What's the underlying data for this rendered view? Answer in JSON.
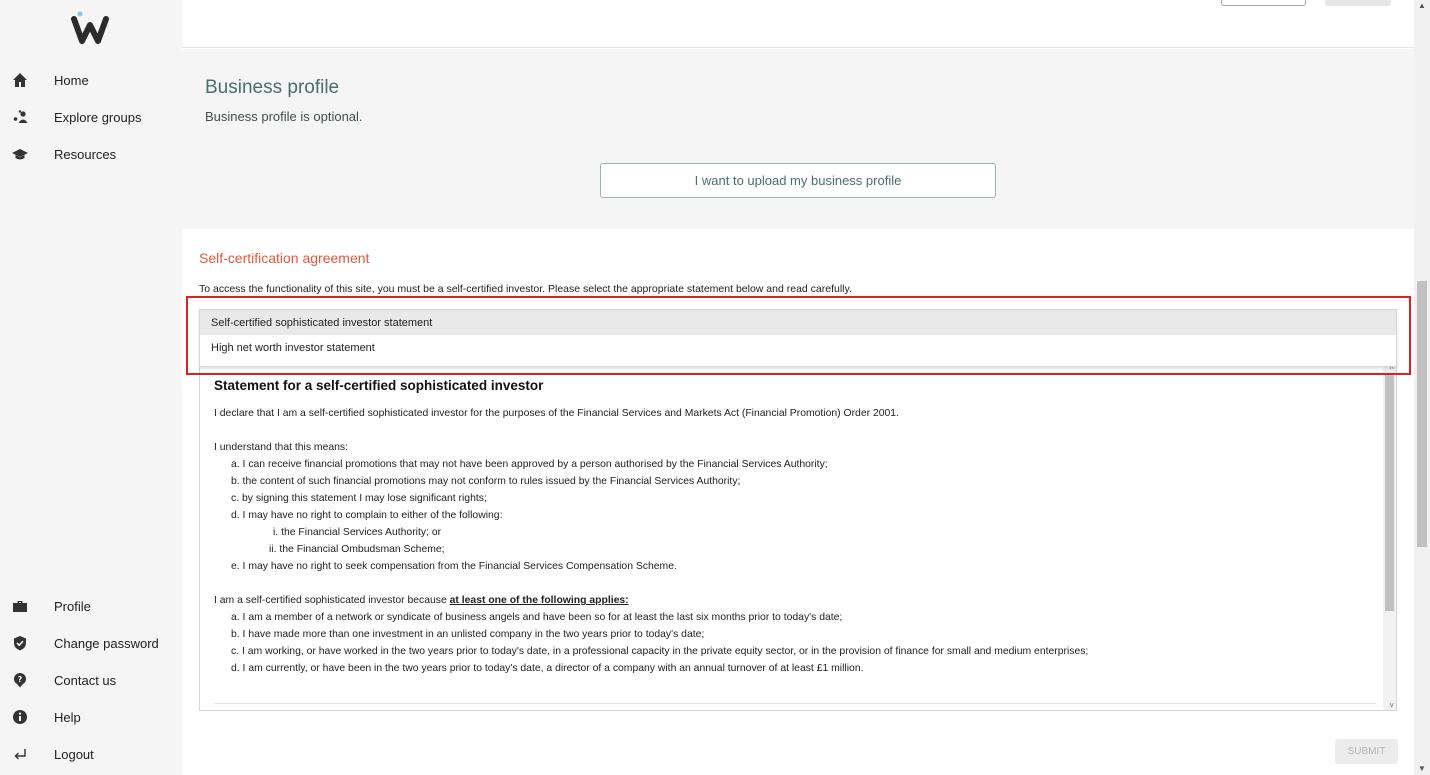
{
  "sidebar": {
    "logo_text": "w",
    "top_items": [
      {
        "label": "Home",
        "icon": "home-icon"
      },
      {
        "label": "Explore groups",
        "icon": "groups-icon"
      },
      {
        "label": "Resources",
        "icon": "graduation-cap-icon"
      }
    ],
    "bottom_items": [
      {
        "label": "Profile",
        "icon": "briefcase-icon"
      },
      {
        "label": "Change password",
        "icon": "shield-icon"
      },
      {
        "label": "Contact us",
        "icon": "question-icon"
      },
      {
        "label": "Help",
        "icon": "info-icon"
      },
      {
        "label": "Logout",
        "icon": "logout-icon"
      }
    ]
  },
  "business": {
    "title": "Business profile",
    "subtitle": "Business profile is optional.",
    "upload_label": "I want to upload my business profile"
  },
  "certification": {
    "title": "Self-certification agreement",
    "description": "To access the functionality of this site, you must be a self-certified investor. Please select the appropriate statement below and read carefully.",
    "options": [
      "Self-certified sophisticated investor statement",
      "High net worth investor statement"
    ],
    "selected_index": 0
  },
  "statement": {
    "heading": "Statement for a self-certified sophisticated investor",
    "declaration": "I declare that I am a self-certified sophisticated investor for the purposes of the Financial Services and Markets Act (Financial Promotion) Order 2001.",
    "understand_intro": "I understand that this means:",
    "understand_items": [
      "a. I can receive financial promotions that may not have been approved by a person authorised by the Financial Services Authority;",
      "b. the content of such financial promotions may not conform to rules issued by the Financial Services Authority;",
      "c. by signing this statement I may lose significant rights;",
      "d. I may have no right to complain to either of the following:"
    ],
    "sub_items": [
      "i. the Financial Services Authority; or",
      "ii. the Financial Ombudsman Scheme;"
    ],
    "understand_last": "e. I may have no right to seek compensation from the Financial Services Compensation Scheme.",
    "because_intro": "I am a self-certified sophisticated investor because ",
    "because_emphasis": "at least one of the following applies:",
    "because_items": [
      "a. I am a member of a network or syndicate of business angels and have been so for at least the last six months prior to today's date;",
      "b. I have made more than one investment in an unlisted company in the two years prior to today's date;",
      "c. I am working, or have worked in the two years prior to today's date, in a professional capacity in the private equity sector, or in the provision of finance for small and medium enterprises;",
      "d. I am currently, or have been in the two years prior to today's date, a director of a company with an annual turnover of at least £1 million."
    ]
  },
  "submit_label": "SUBMIT",
  "colors": {
    "accent_title": "#4a6f6b",
    "cert_title": "#e0573f",
    "highlight_border": "#e02020"
  }
}
